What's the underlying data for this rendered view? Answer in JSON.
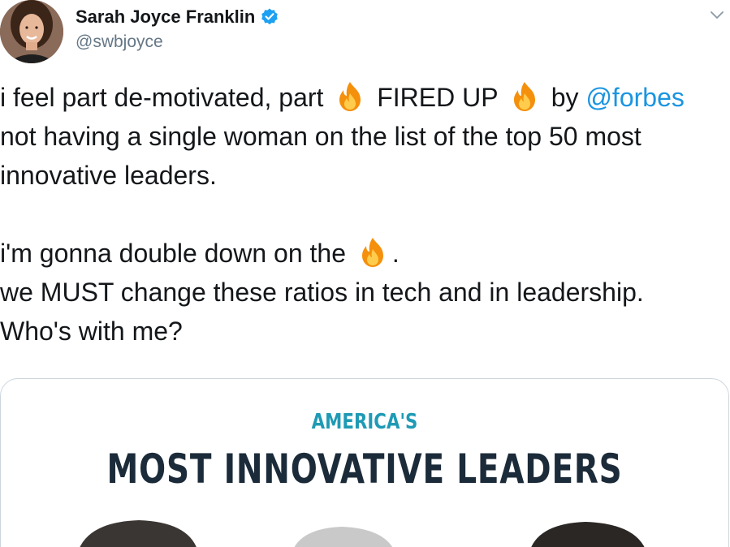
{
  "author": {
    "display_name": "Sarah Joyce Franklin",
    "handle": "@swbjoyce",
    "verified": true,
    "avatar_icon": "avatar-portrait"
  },
  "menu": {
    "icon": "chevron-down-icon"
  },
  "tweet": {
    "line1_a": "i feel part de-motivated, part",
    "line1_b": "FIRED UP",
    "line1_c": "by",
    "mention": "@forbes",
    "line2": "not having a single woman on the list of the top 50 most",
    "line3": "innovative leaders.",
    "line4_a": "i'm gonna double down on the",
    "line4_b": ".",
    "line5": "we MUST change these ratios in tech and in leadership.",
    "line6": "Who's with me?",
    "emoji_icon": "fire-icon"
  },
  "media": {
    "kicker": "AMERICA'S",
    "title": "MOST INNOVATIVE LEADERS"
  },
  "colors": {
    "link": "#1b95e0",
    "verified": "#1da1f2",
    "kicker": "#1f9ab5",
    "title": "#1c2b39",
    "secondary": "#657786"
  }
}
